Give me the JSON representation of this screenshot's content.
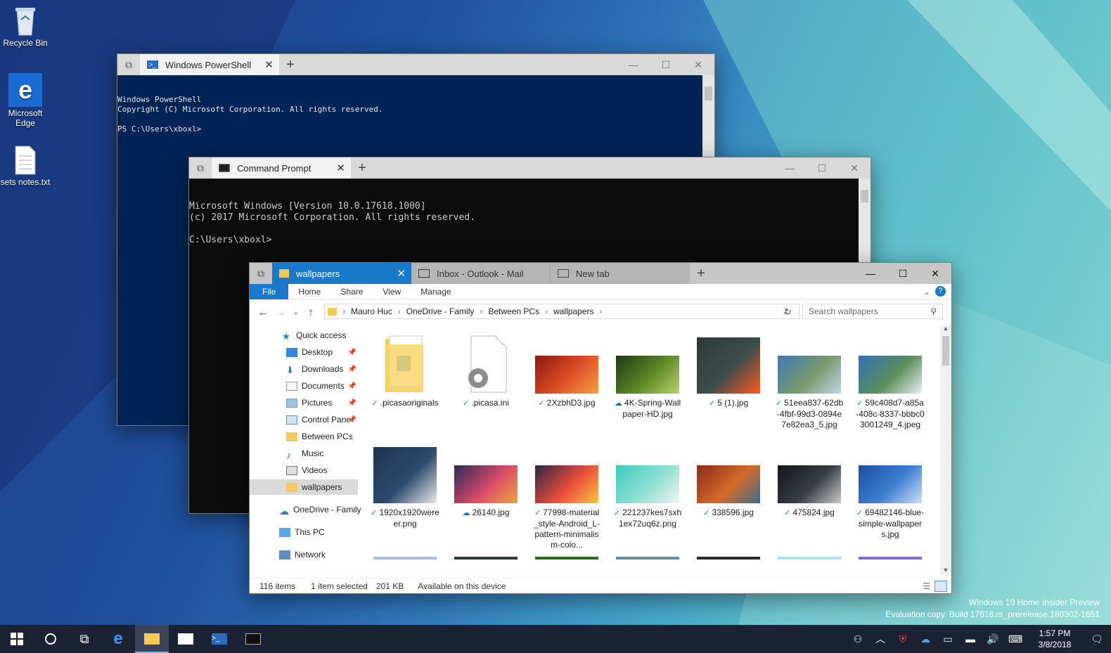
{
  "desktop": {
    "icons": [
      {
        "label": "Recycle Bin",
        "icon": "recycle-bin-icon"
      },
      {
        "label": "Microsoft Edge",
        "icon": "edge-icon"
      },
      {
        "label": "sets notes.txt",
        "icon": "text-file-icon"
      }
    ]
  },
  "powershell": {
    "tab_title": "Windows PowerShell",
    "lines": "Windows PowerShell\nCopyright (C) Microsoft Corporation. All rights reserved.\n\nPS C:\\Users\\xboxl>"
  },
  "cmd": {
    "tab_title": "Command Prompt",
    "lines": "Microsoft Windows [Version 10.0.17618.1000]\n(c) 2017 Microsoft Corporation. All rights reserved.\n\nC:\\Users\\xboxl>"
  },
  "explorer": {
    "tabs": [
      {
        "label": "wallpapers",
        "active": true
      },
      {
        "label": "Inbox - Outlook - Mail",
        "active": false
      },
      {
        "label": "New tab",
        "active": false
      }
    ],
    "ribbon": [
      "File",
      "Home",
      "Share",
      "View",
      "Manage"
    ],
    "breadcrumb": [
      "Mauro Huc",
      "OneDrive - Family",
      "Between PCs",
      "wallpapers"
    ],
    "search_placeholder": "Search wallpapers",
    "nav": [
      {
        "label": "Quick access",
        "icon": "star-icon",
        "pinned": false,
        "selected": false
      },
      {
        "label": "Desktop",
        "icon": "desktop-icon",
        "pinned": true,
        "selected": false
      },
      {
        "label": "Downloads",
        "icon": "download-icon",
        "pinned": true,
        "selected": false
      },
      {
        "label": "Documents",
        "icon": "documents-icon",
        "pinned": true,
        "selected": false
      },
      {
        "label": "Pictures",
        "icon": "pictures-icon",
        "pinned": true,
        "selected": false
      },
      {
        "label": "Control Pane",
        "icon": "control-panel-icon",
        "pinned": true,
        "selected": false
      },
      {
        "label": "Between PCs",
        "icon": "folder-icon",
        "pinned": false,
        "selected": false
      },
      {
        "label": "Music",
        "icon": "music-icon",
        "pinned": false,
        "selected": false
      },
      {
        "label": "Videos",
        "icon": "videos-icon",
        "pinned": false,
        "selected": false
      },
      {
        "label": "wallpapers",
        "icon": "folder-icon",
        "pinned": false,
        "selected": true
      },
      {
        "label": "OneDrive - Family",
        "icon": "onedrive-icon",
        "pinned": false,
        "selected": false
      },
      {
        "label": "This PC",
        "icon": "pc-icon",
        "pinned": false,
        "selected": false
      },
      {
        "label": "Network",
        "icon": "network-icon",
        "pinned": false,
        "selected": false
      }
    ],
    "files": [
      {
        "name": ".picasaoriginals",
        "status": "synced",
        "kind": "folder"
      },
      {
        "name": ".picasa.ini",
        "status": "synced",
        "kind": "settings"
      },
      {
        "name": "2XzbhD3.jpg",
        "status": "synced",
        "kind": "image",
        "colors": [
          "#8a1a0c",
          "#e0502a",
          "#f4a040"
        ]
      },
      {
        "name": "4K-Spring-Wallpaper-HD.jpg",
        "status": "cloud",
        "kind": "image",
        "colors": [
          "#1d3a12",
          "#5e8a2a",
          "#b9d26a"
        ]
      },
      {
        "name": "5 (1).jpg",
        "status": "synced",
        "kind": "image",
        "colors": [
          "#2c3a3a",
          "#3f4d4d",
          "#ff5a1f"
        ]
      },
      {
        "name": "51eea837-62db-4fbf-99d3-0894e7e82ea3_5.jpg",
        "status": "synced",
        "kind": "image",
        "colors": [
          "#3d78b7",
          "#7a9b6a",
          "#bcd6ee"
        ]
      },
      {
        "name": "59c408d7-a85a-408c-8337-bbbc03001249_4.jpeg",
        "status": "synced",
        "kind": "image",
        "colors": [
          "#2f71b8",
          "#5c8f59",
          "#e8f0f6"
        ]
      },
      {
        "name": "1920x1920wereer.png",
        "status": "synced",
        "kind": "image",
        "colors": [
          "#1e3450",
          "#2c4a6c",
          "#e8e8e8"
        ]
      },
      {
        "name": "26140.jpg",
        "status": "cloud",
        "kind": "image",
        "colors": [
          "#2a2c5a",
          "#d84a6a",
          "#f2a13a"
        ]
      },
      {
        "name": "77998-material_style-Android_L-pattern-minimalism-colo...",
        "status": "synced",
        "kind": "image",
        "colors": [
          "#2b2745",
          "#e94d3a",
          "#f6c545"
        ]
      },
      {
        "name": "221237kes7sxh1ex72uq6z.png",
        "status": "synced",
        "kind": "image",
        "colors": [
          "#3dc8c0",
          "#8fe0d3",
          "#f3f3f3"
        ]
      },
      {
        "name": "338596.jpg",
        "status": "synced",
        "kind": "image",
        "colors": [
          "#8a2c1a",
          "#d46a2a",
          "#3f6d8a"
        ]
      },
      {
        "name": "475824.jpg",
        "status": "synced",
        "kind": "image",
        "colors": [
          "#121519",
          "#3a3f45",
          "#c9c9c9"
        ]
      },
      {
        "name": "69482146-blue-simple-wallpapers.jpg",
        "status": "synced",
        "kind": "image",
        "colors": [
          "#1a4fa0",
          "#3f7fd0",
          "#cfe0f7"
        ]
      }
    ],
    "status": {
      "count": "116 items",
      "selected": "1 item selected",
      "size": "201 KB",
      "availability": "Available on this device"
    }
  },
  "watermark": {
    "line1": "Windows 10 Home Insider Preview",
    "line2": "Evaluation copy. Build 17618.rs_prerelease.180302-1651"
  },
  "clock": {
    "time": "1:57 PM",
    "date": "3/8/2018"
  }
}
